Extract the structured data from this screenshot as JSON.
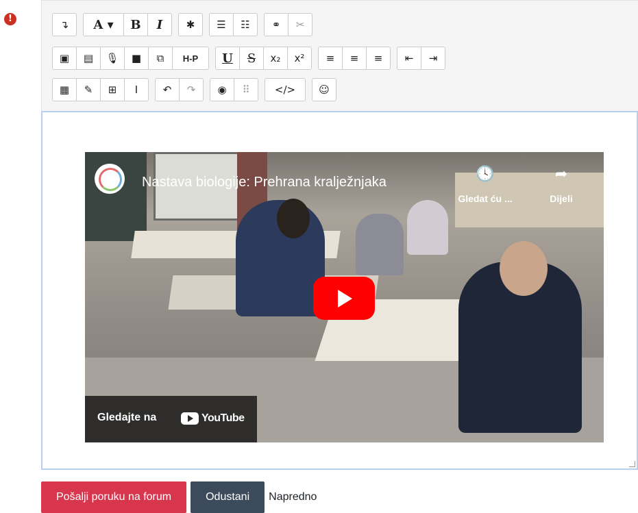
{
  "required_icon": "!",
  "toolbar": {
    "row1": [
      [
        {
          "name": "toolbar-toggle-icon",
          "glyph": "↴"
        }
      ],
      [
        {
          "name": "font-color-icon",
          "glyph": "A ▾",
          "style": "serif"
        },
        {
          "name": "bold-icon",
          "glyph": "B",
          "style": "serif"
        },
        {
          "name": "italic-icon",
          "glyph": "I",
          "style": "serif-italic"
        }
      ],
      [
        {
          "name": "settings-gear-icon",
          "glyph": "✱"
        }
      ],
      [
        {
          "name": "bullet-list-icon",
          "glyph": "☰"
        },
        {
          "name": "numbered-list-icon",
          "glyph": "☷"
        }
      ],
      [
        {
          "name": "link-icon",
          "glyph": "⚭"
        },
        {
          "name": "unlink-icon",
          "glyph": "✂",
          "dim": true
        }
      ]
    ],
    "row2": [
      [
        {
          "name": "insert-image-icon",
          "glyph": "▣"
        },
        {
          "name": "insert-media-icon",
          "glyph": "▤"
        },
        {
          "name": "record-audio-icon",
          "glyph": "🎙"
        },
        {
          "name": "record-video-icon",
          "glyph": "■"
        },
        {
          "name": "manage-files-icon",
          "glyph": "⧉"
        },
        {
          "name": "h5p-icon",
          "glyph": "H-P",
          "style": "h5p"
        }
      ],
      [
        {
          "name": "underline-icon",
          "glyph": "U",
          "style": "serif-underline"
        },
        {
          "name": "strikethrough-icon",
          "glyph": "S",
          "style": "strike"
        },
        {
          "name": "subscript-icon",
          "glyph": "x₂"
        },
        {
          "name": "superscript-icon",
          "glyph": "x²"
        }
      ],
      [
        {
          "name": "align-left-icon",
          "glyph": "≡"
        },
        {
          "name": "align-center-icon",
          "glyph": "≡"
        },
        {
          "name": "align-right-icon",
          "glyph": "≡"
        }
      ],
      [
        {
          "name": "outdent-icon",
          "glyph": "⇤"
        },
        {
          "name": "indent-icon",
          "glyph": "⇥"
        }
      ]
    ],
    "row3": [
      [
        {
          "name": "equation-editor-icon",
          "glyph": "▦"
        },
        {
          "name": "special-character-icon",
          "glyph": "✎"
        },
        {
          "name": "table-icon",
          "glyph": "⊞"
        },
        {
          "name": "clear-formatting-icon",
          "glyph": "I"
        }
      ],
      [
        {
          "name": "undo-icon",
          "glyph": "↶"
        },
        {
          "name": "redo-icon",
          "glyph": "↷",
          "dim": true
        }
      ],
      [
        {
          "name": "accessibility-checker-icon",
          "glyph": "◉"
        },
        {
          "name": "screenreader-helper-icon",
          "glyph": "⠿",
          "dim": true
        }
      ],
      [
        {
          "name": "html-icon",
          "glyph": "</>"
        }
      ],
      [
        {
          "name": "emoji-icon",
          "glyph": "☺"
        }
      ]
    ]
  },
  "video": {
    "title": "Nastava biologije: Prehrana kralježnjaka",
    "watch_later_label": "Gledat ću ...",
    "share_label": "Dijeli",
    "watch_on_label": "Gledajte na",
    "youtube_label": "YouTube",
    "watch_later_icon": "clock-icon",
    "share_icon": "share-arrow-icon",
    "play_icon": "play-icon"
  },
  "actions": {
    "submit_label": "Pošalji poruku na forum",
    "cancel_label": "Odustani",
    "advanced_label": "Napredno"
  },
  "colors": {
    "submit": "#d8364d",
    "cancel": "#3c4b5c",
    "required": "#ca3120",
    "youtube_red": "#ff0000",
    "editor_focus_border": "#b6d1ef"
  }
}
